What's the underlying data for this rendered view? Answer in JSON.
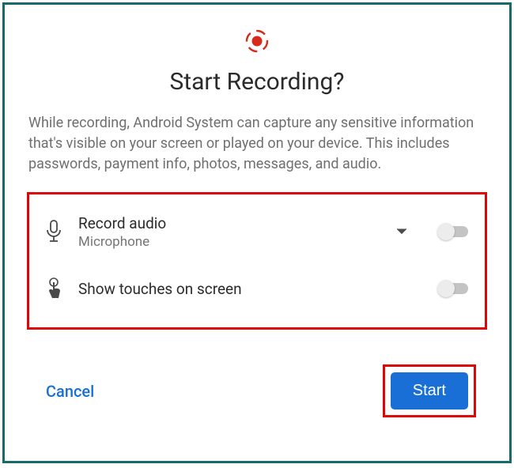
{
  "dialog": {
    "title": "Start Recording?",
    "body": "While recording, Android System can capture any sensitive information that's visible on your screen or played on your device. This includes passwords, payment info, photos, messages, and audio."
  },
  "options": {
    "record_audio": {
      "title": "Record audio",
      "subtitle": "Microphone",
      "toggle_on": false
    },
    "show_touches": {
      "title": "Show touches on screen",
      "toggle_on": false
    }
  },
  "actions": {
    "cancel": "Cancel",
    "start": "Start"
  },
  "colors": {
    "highlight_red": "#de0505",
    "primary_blue": "#1a6fd6",
    "frame_teal": "#186a6a"
  }
}
